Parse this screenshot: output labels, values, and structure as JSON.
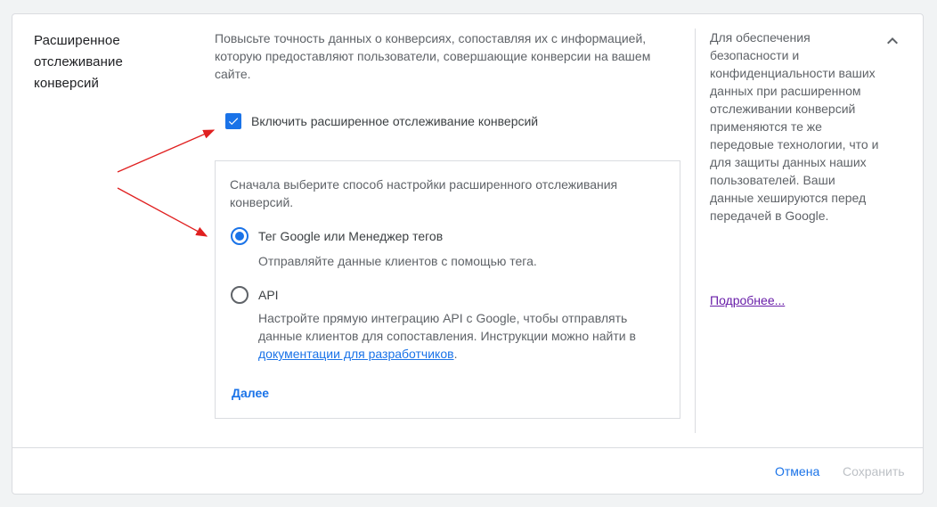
{
  "section": {
    "title": "Расширенное отслеживание конверсий",
    "intro": "Повысьте точность данных о конверсиях, сопоставляя их с информацией, которую предоставляют пользователи, совершающие конверсии на вашем сайте."
  },
  "enable": {
    "label": "Включить расширенное отслеживание конверсий",
    "checked": true
  },
  "options": {
    "intro": "Сначала выберите способ настройки расширенного отслеживания конверсий.",
    "tag": {
      "label": "Тег Google или Менеджер тегов",
      "description": "Отправляйте данные клиентов с помощью тега.",
      "selected": true
    },
    "api": {
      "label": "API",
      "description_before": "Настройте прямую интеграцию API с Google, чтобы отправлять данные клиентов для сопоставления. Инструкции можно найти в ",
      "link": "документации для разработчиков",
      "description_after": ".",
      "selected": false
    },
    "next_label": "Далее"
  },
  "side": {
    "text": "Для обеспечения безопасности и конфиденциальности ваших данных при расширенном отслеживании конверсий применяются те же передовые технологии, что и для защиты данных наших пользователей. Ваши данные хешируются перед передачей в Google.",
    "learn_more": "Подробнее..."
  },
  "footer": {
    "cancel_label": "Отмена",
    "save_label": "Сохранить"
  },
  "colors": {
    "accent": "#1a73e8",
    "annotation_arrow": "#e02020",
    "visited_link": "#681da8",
    "disabled_text": "#bdc1c6"
  },
  "icons": {
    "checkbox": "checkmark-icon",
    "collapse": "chevron-up-icon"
  }
}
